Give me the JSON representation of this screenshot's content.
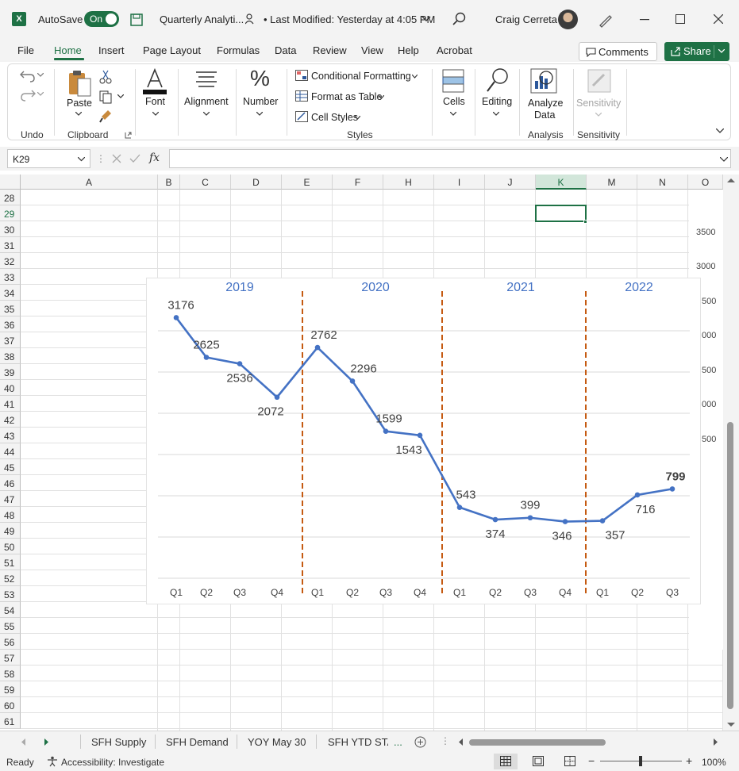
{
  "titlebar": {
    "autosave_label": "AutoSave",
    "toggle_label": "On",
    "file_title": "Quarterly Analyti...",
    "modified": "• Last Modified: Yesterday at 4:05 PM",
    "user_name": "Craig Cerreta"
  },
  "menu": {
    "items": [
      "File",
      "Home",
      "Insert",
      "Page Layout",
      "Formulas",
      "Data",
      "Review",
      "View",
      "Help",
      "Acrobat"
    ],
    "active": "Home",
    "comments_label": "Comments",
    "share_label": "Share"
  },
  "ribbon": {
    "undo_group": "Undo",
    "paste_label": "Paste",
    "clipboard_group": "Clipboard",
    "font_label": "Font",
    "alignment_label": "Alignment",
    "number_label": "Number",
    "conditional_formatting": "Conditional Formatting",
    "format_as_table": "Format as Table",
    "cell_styles": "Cell Styles",
    "styles_group": "Styles",
    "cells_label": "Cells",
    "editing_label": "Editing",
    "analyze_data_1": "Analyze",
    "analyze_data_2": "Data",
    "analysis_group": "Analysis",
    "sensitivity_label": "Sensitivity",
    "sensitivity_group": "Sensitivity"
  },
  "formula_bar": {
    "name_box": "K29",
    "fx": "fx",
    "value": ""
  },
  "grid": {
    "columns": [
      "A",
      "B",
      "C",
      "D",
      "E",
      "F",
      "H",
      "I",
      "J",
      "K",
      "M",
      "N",
      "O"
    ],
    "selected_column": "K",
    "rows": [
      "28",
      "29",
      "30",
      "31",
      "32",
      "33",
      "34",
      "35",
      "36",
      "37",
      "38",
      "39",
      "40",
      "41",
      "42",
      "43",
      "44",
      "45",
      "46",
      "47",
      "48",
      "49",
      "50",
      "51",
      "52",
      "53",
      "54",
      "55",
      "56",
      "57",
      "58",
      "59",
      "60",
      "61"
    ],
    "selected_row": "29",
    "bg_axis_labels": [
      "3500",
      "3000",
      "500",
      "000",
      "500",
      "000",
      "500"
    ]
  },
  "chart_data": {
    "type": "line",
    "years": [
      "2019",
      "2020",
      "2021",
      "2022"
    ],
    "categories": [
      "Q1",
      "Q2",
      "Q3",
      "Q4",
      "Q1",
      "Q2",
      "Q3",
      "Q4",
      "Q1",
      "Q2",
      "Q3",
      "Q4",
      "Q1",
      "Q2",
      "Q3"
    ],
    "values": [
      3176,
      2625,
      2536,
      2072,
      2762,
      2296,
      1599,
      1543,
      543,
      374,
      399,
      346,
      357,
      716,
      799
    ],
    "ylim": [
      0,
      3500
    ],
    "grid": true,
    "legend": "none",
    "line_color": "#4472c4",
    "divider_color": "#c55a11",
    "year_color": "#4472c4",
    "highlight_last": true
  },
  "sheet_tabs": {
    "tabs": [
      "SFH Supply",
      "SFH Demand",
      "YOY May 30",
      "SFH YTD STA"
    ],
    "more": "..."
  },
  "status": {
    "ready": "Ready",
    "accessibility": "Accessibility: Investigate",
    "zoom": "100%"
  }
}
